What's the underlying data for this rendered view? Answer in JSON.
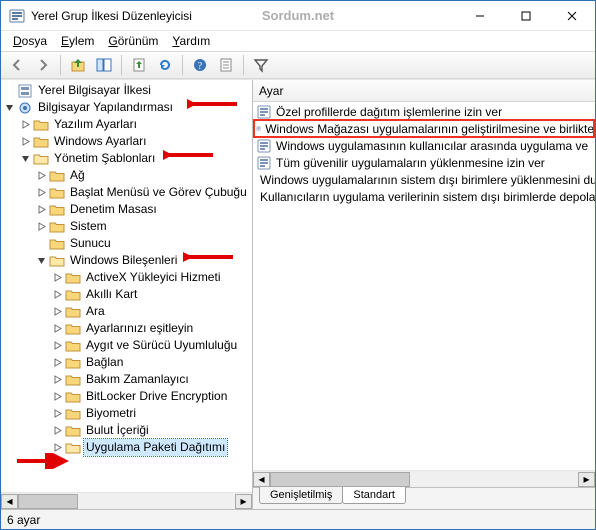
{
  "window": {
    "title": "Yerel Grup İlkesi Düzenleyicisi",
    "watermark": "Sordum.net"
  },
  "menu": {
    "file": "Dosya",
    "action": "Eylem",
    "view": "Görünüm",
    "help": "Yardım"
  },
  "tree": {
    "root": "Yerel Bilgisayar İlkesi",
    "computer_config": "Bilgisayar Yapılandırması",
    "software_settings": "Yazılım Ayarları",
    "windows_settings": "Windows Ayarları",
    "admin_templates": "Yönetim Şablonları",
    "network": "Ağ",
    "start_taskbar": "Başlat Menüsü ve Görev Çubuğu",
    "control_panel": "Denetim Masası",
    "system": "Sistem",
    "server": "Sunucu",
    "windows_components": "Windows Bileşenleri",
    "wc_items": [
      "ActiveX Yükleyici Hizmeti",
      "Akıllı Kart",
      "Ara",
      "Ayarlarınızı eşitleyin",
      "Aygıt ve Sürücü Uyumluluğu",
      "Bağlan",
      "Bakım Zamanlayıcı",
      "BitLocker Drive Encryption",
      "Biyometri",
      "Bulut İçeriği",
      "Uygulama Paketi Dağıtımı"
    ]
  },
  "list": {
    "header": "Ayar",
    "items": [
      "Özel profillerde dağıtım işlemlerine izin ver",
      "Windows Mağazası uygulamalarının geliştirilmesine ve birlikte",
      "Windows uygulamasının kullanıcılar arasında uygulama ve",
      "Tüm güvenilir uygulamaların yüklenmesine izin ver",
      "Windows uygulamalarının sistem dışı birimlere yüklenmesini durdur",
      "Kullanıcıların uygulama verilerinin sistem dışı birimlerde depolanmasını"
    ],
    "highlight_index": 1
  },
  "tabs": {
    "extended": "Genişletilmiş",
    "standard": "Standart"
  },
  "statusbar": "6 ayar"
}
